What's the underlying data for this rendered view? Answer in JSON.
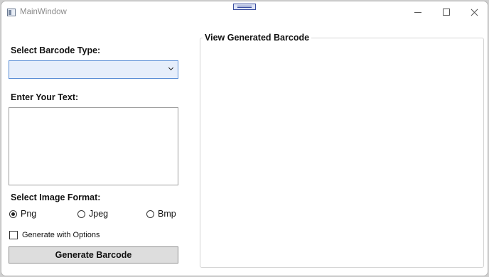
{
  "window": {
    "title": "MainWindow"
  },
  "left_panel": {
    "barcode_type_label": "Select Barcode Type:",
    "barcode_type_value": "",
    "text_label": "Enter Your Text:",
    "text_value": "",
    "image_format_label": "Select Image Format:",
    "formats": [
      {
        "label": "Png",
        "checked": true
      },
      {
        "label": "Jpeg",
        "checked": false
      },
      {
        "label": "Bmp",
        "checked": false
      }
    ],
    "options_checkbox_label": "Generate with Options",
    "options_checked": false,
    "generate_button_label": "Generate Barcode"
  },
  "right_panel": {
    "group_title": "View Generated Barcode"
  },
  "colors": {
    "combo_border": "#5b8fd6",
    "combo_fill": "#e6eefb",
    "button_fill": "#dddddd"
  },
  "icons": [
    "app-window-icon",
    "drag-grip-icon",
    "minimize-icon",
    "maximize-icon",
    "close-icon",
    "chevron-down-icon"
  ]
}
